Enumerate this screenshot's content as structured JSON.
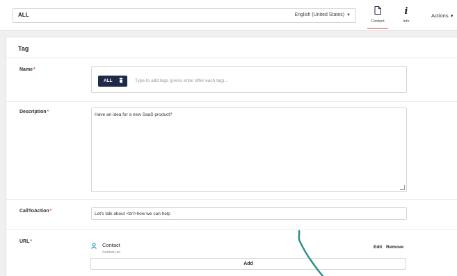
{
  "header": {
    "name_value": "ALL",
    "language": "English (United States)",
    "tabs": [
      {
        "label": "Content",
        "icon": "document-icon",
        "active": true
      },
      {
        "label": "Info",
        "icon": "info-icon",
        "active": false
      }
    ],
    "actions_label": "Actions"
  },
  "panel": {
    "title": "Tag",
    "fields": {
      "name": {
        "label": "Name",
        "required_mark": "*",
        "tag": "ALL",
        "placeholder": "Type to add tags (press enter after each tag)..."
      },
      "description": {
        "label": "Description",
        "required_mark": "*",
        "value": "Have an idea for a new SaaS product?"
      },
      "call_to_action": {
        "label": "CallToAction",
        "required_mark": "*",
        "value": "Let's talk about <br/>how we can help"
      },
      "url": {
        "label": "URL",
        "required_mark": "*",
        "item_title": "Contact",
        "item_path": "/contact-us/",
        "edit_label": "Edit",
        "remove_label": "Remove",
        "add_label": "Add"
      }
    }
  },
  "colors": {
    "accent": "#1e2a48",
    "required": "#d9534f",
    "tab_underline": "#e9a0a0",
    "link_icon": "#2b9fb3",
    "pen_stroke": "#2e8f86"
  }
}
